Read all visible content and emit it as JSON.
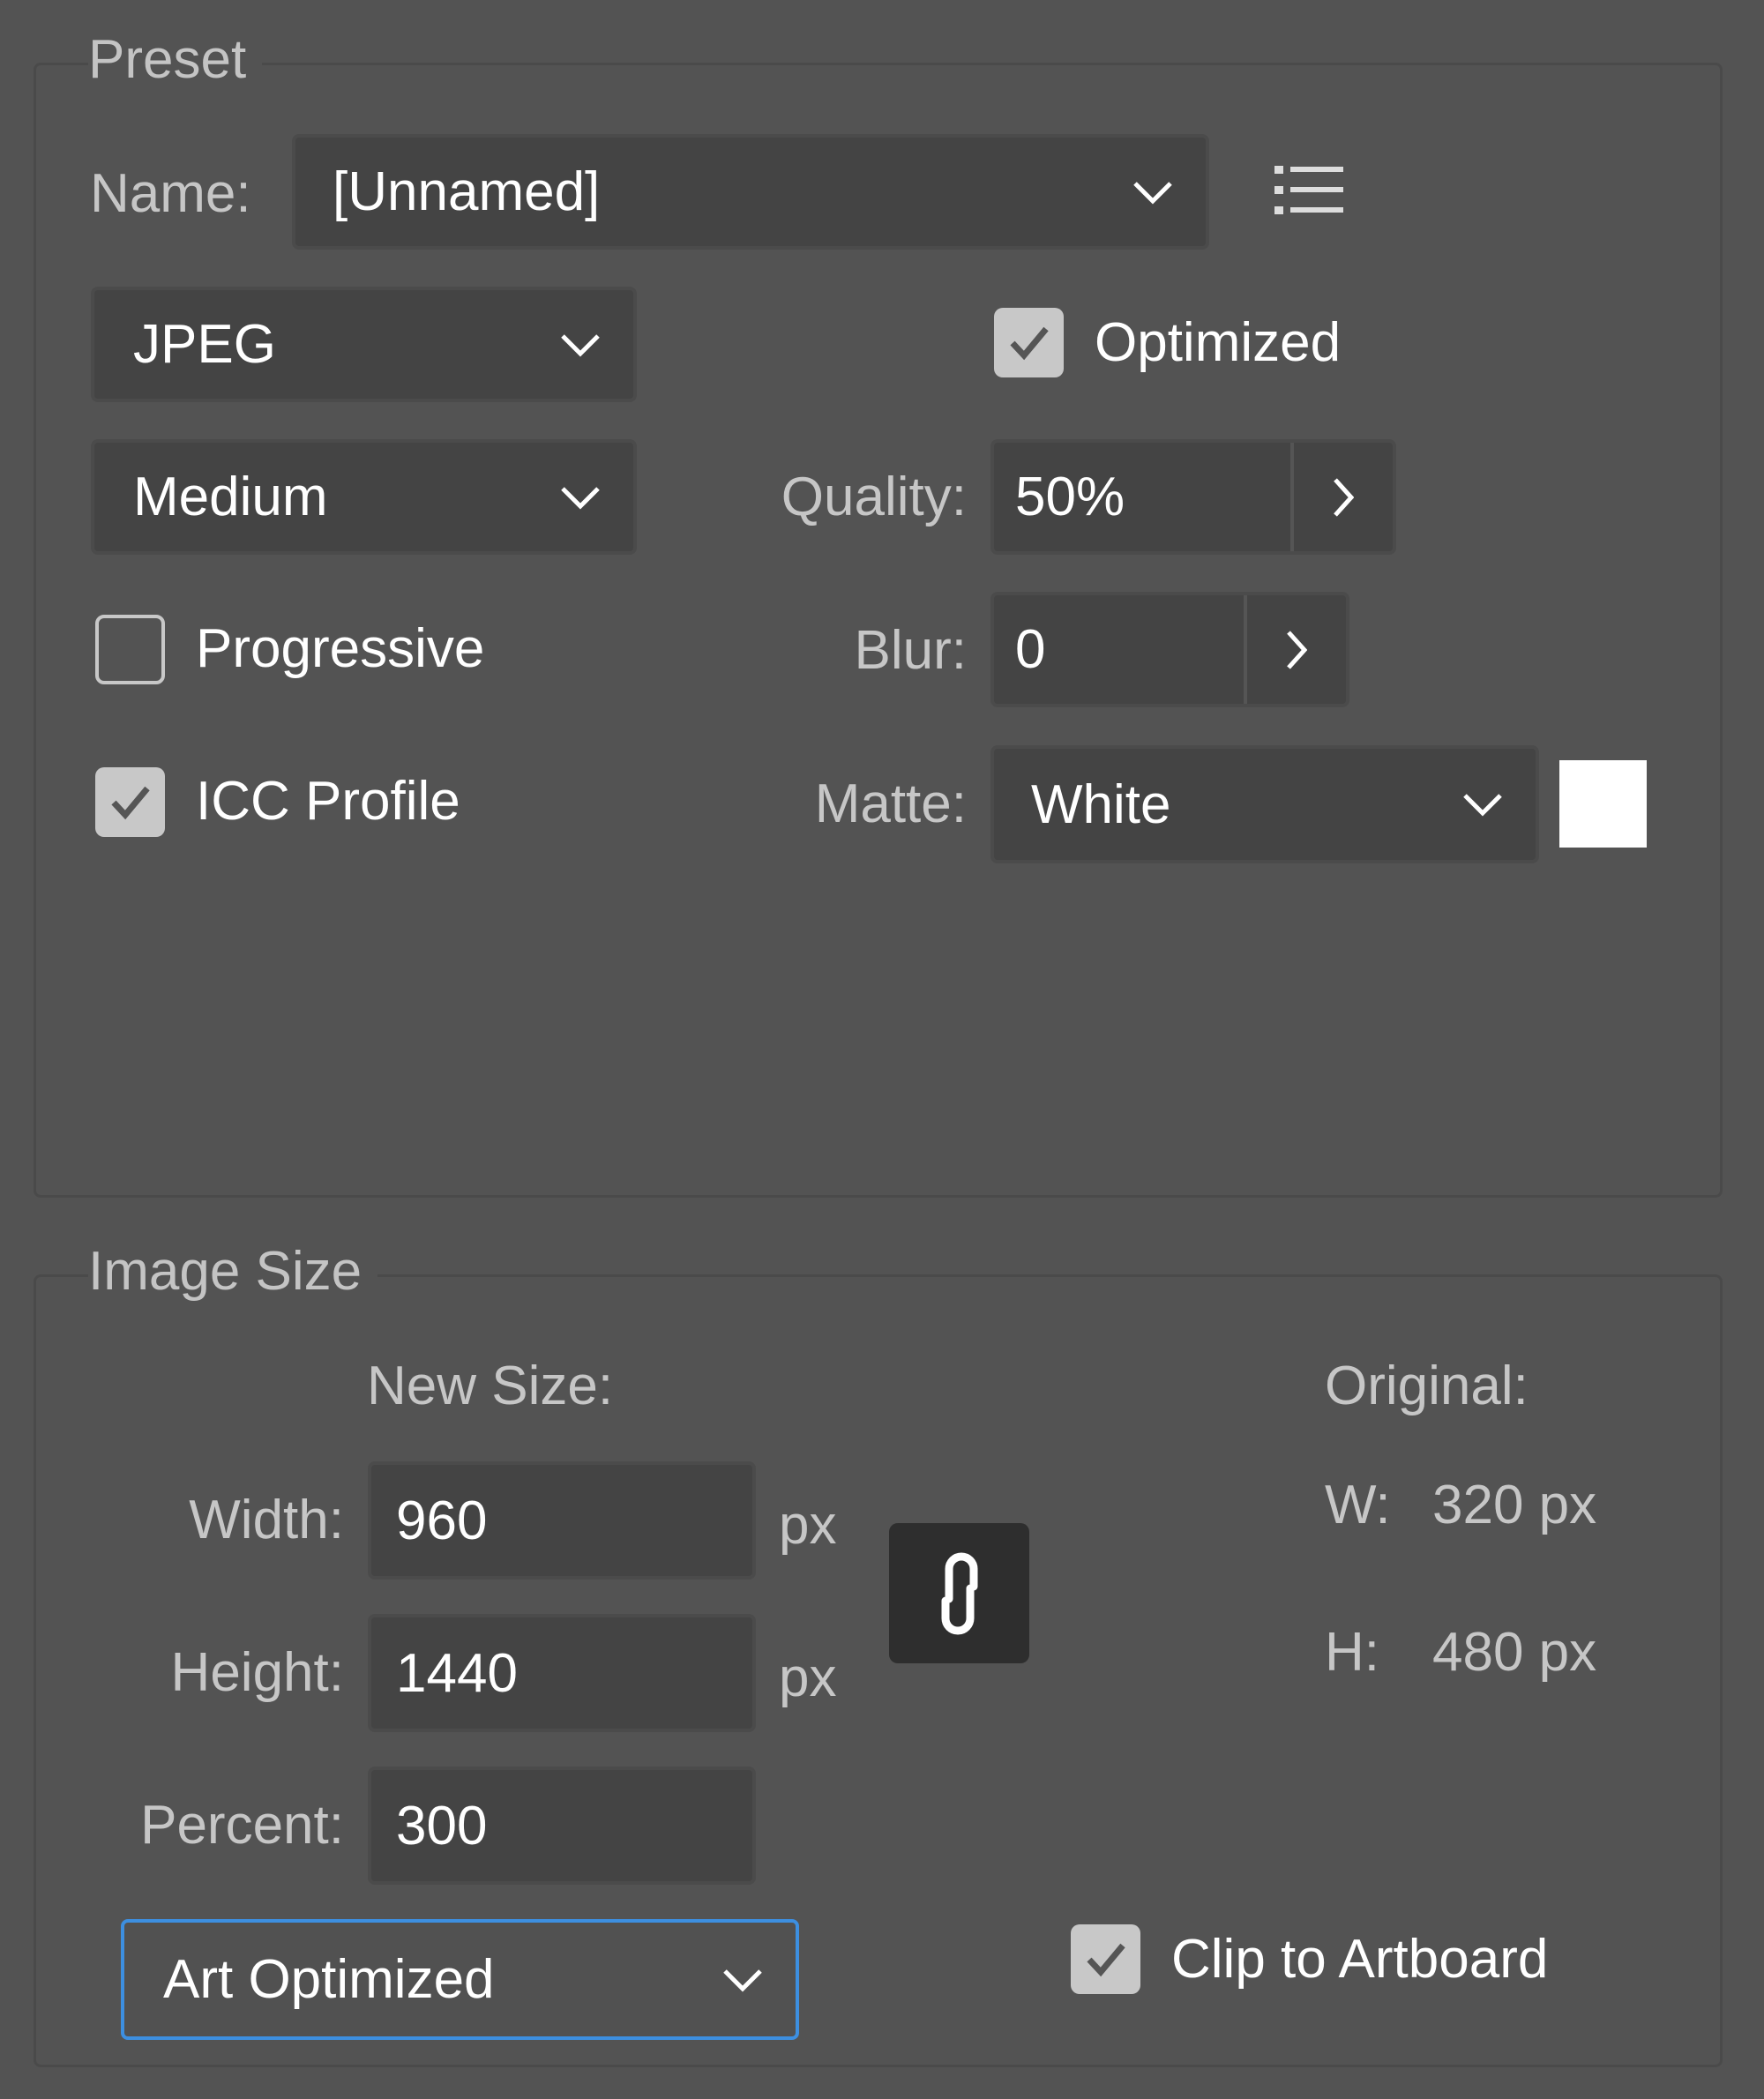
{
  "preset": {
    "legend": "Preset",
    "name_label": "Name:",
    "name_value": "[Unnamed]",
    "presets_menu_icon": "list-icon",
    "format_value": "JPEG",
    "optimized": {
      "label": "Optimized",
      "checked": true
    },
    "quality_preset_value": "Medium",
    "quality": {
      "label": "Quality:",
      "value": "50%"
    },
    "progressive": {
      "label": "Progressive",
      "checked": false
    },
    "blur": {
      "label": "Blur:",
      "value": "0"
    },
    "icc_profile": {
      "label": "ICC Profile",
      "checked": true
    },
    "matte": {
      "label": "Matte:",
      "value": "White",
      "swatch_color": "#ffffff"
    }
  },
  "image_size": {
    "legend": "Image Size",
    "new_size_label": "New Size:",
    "width": {
      "label": "Width:",
      "value": "960",
      "unit": "px"
    },
    "height": {
      "label": "Height:",
      "value": "1440",
      "unit": "px"
    },
    "percent": {
      "label": "Percent:",
      "value": "300"
    },
    "constrain_icon": "link-icon",
    "original_label": "Original:",
    "original_w_label": "W:",
    "original_w_value": "320 px",
    "original_h_label": "H:",
    "original_h_value": "480 px",
    "resample_value": "Art Optimized",
    "clip_to_artboard": {
      "label": "Clip to Artboard",
      "checked": true
    }
  },
  "colors": {
    "background": "#535353",
    "field": "#444444",
    "focus": "#3d8fe0"
  }
}
